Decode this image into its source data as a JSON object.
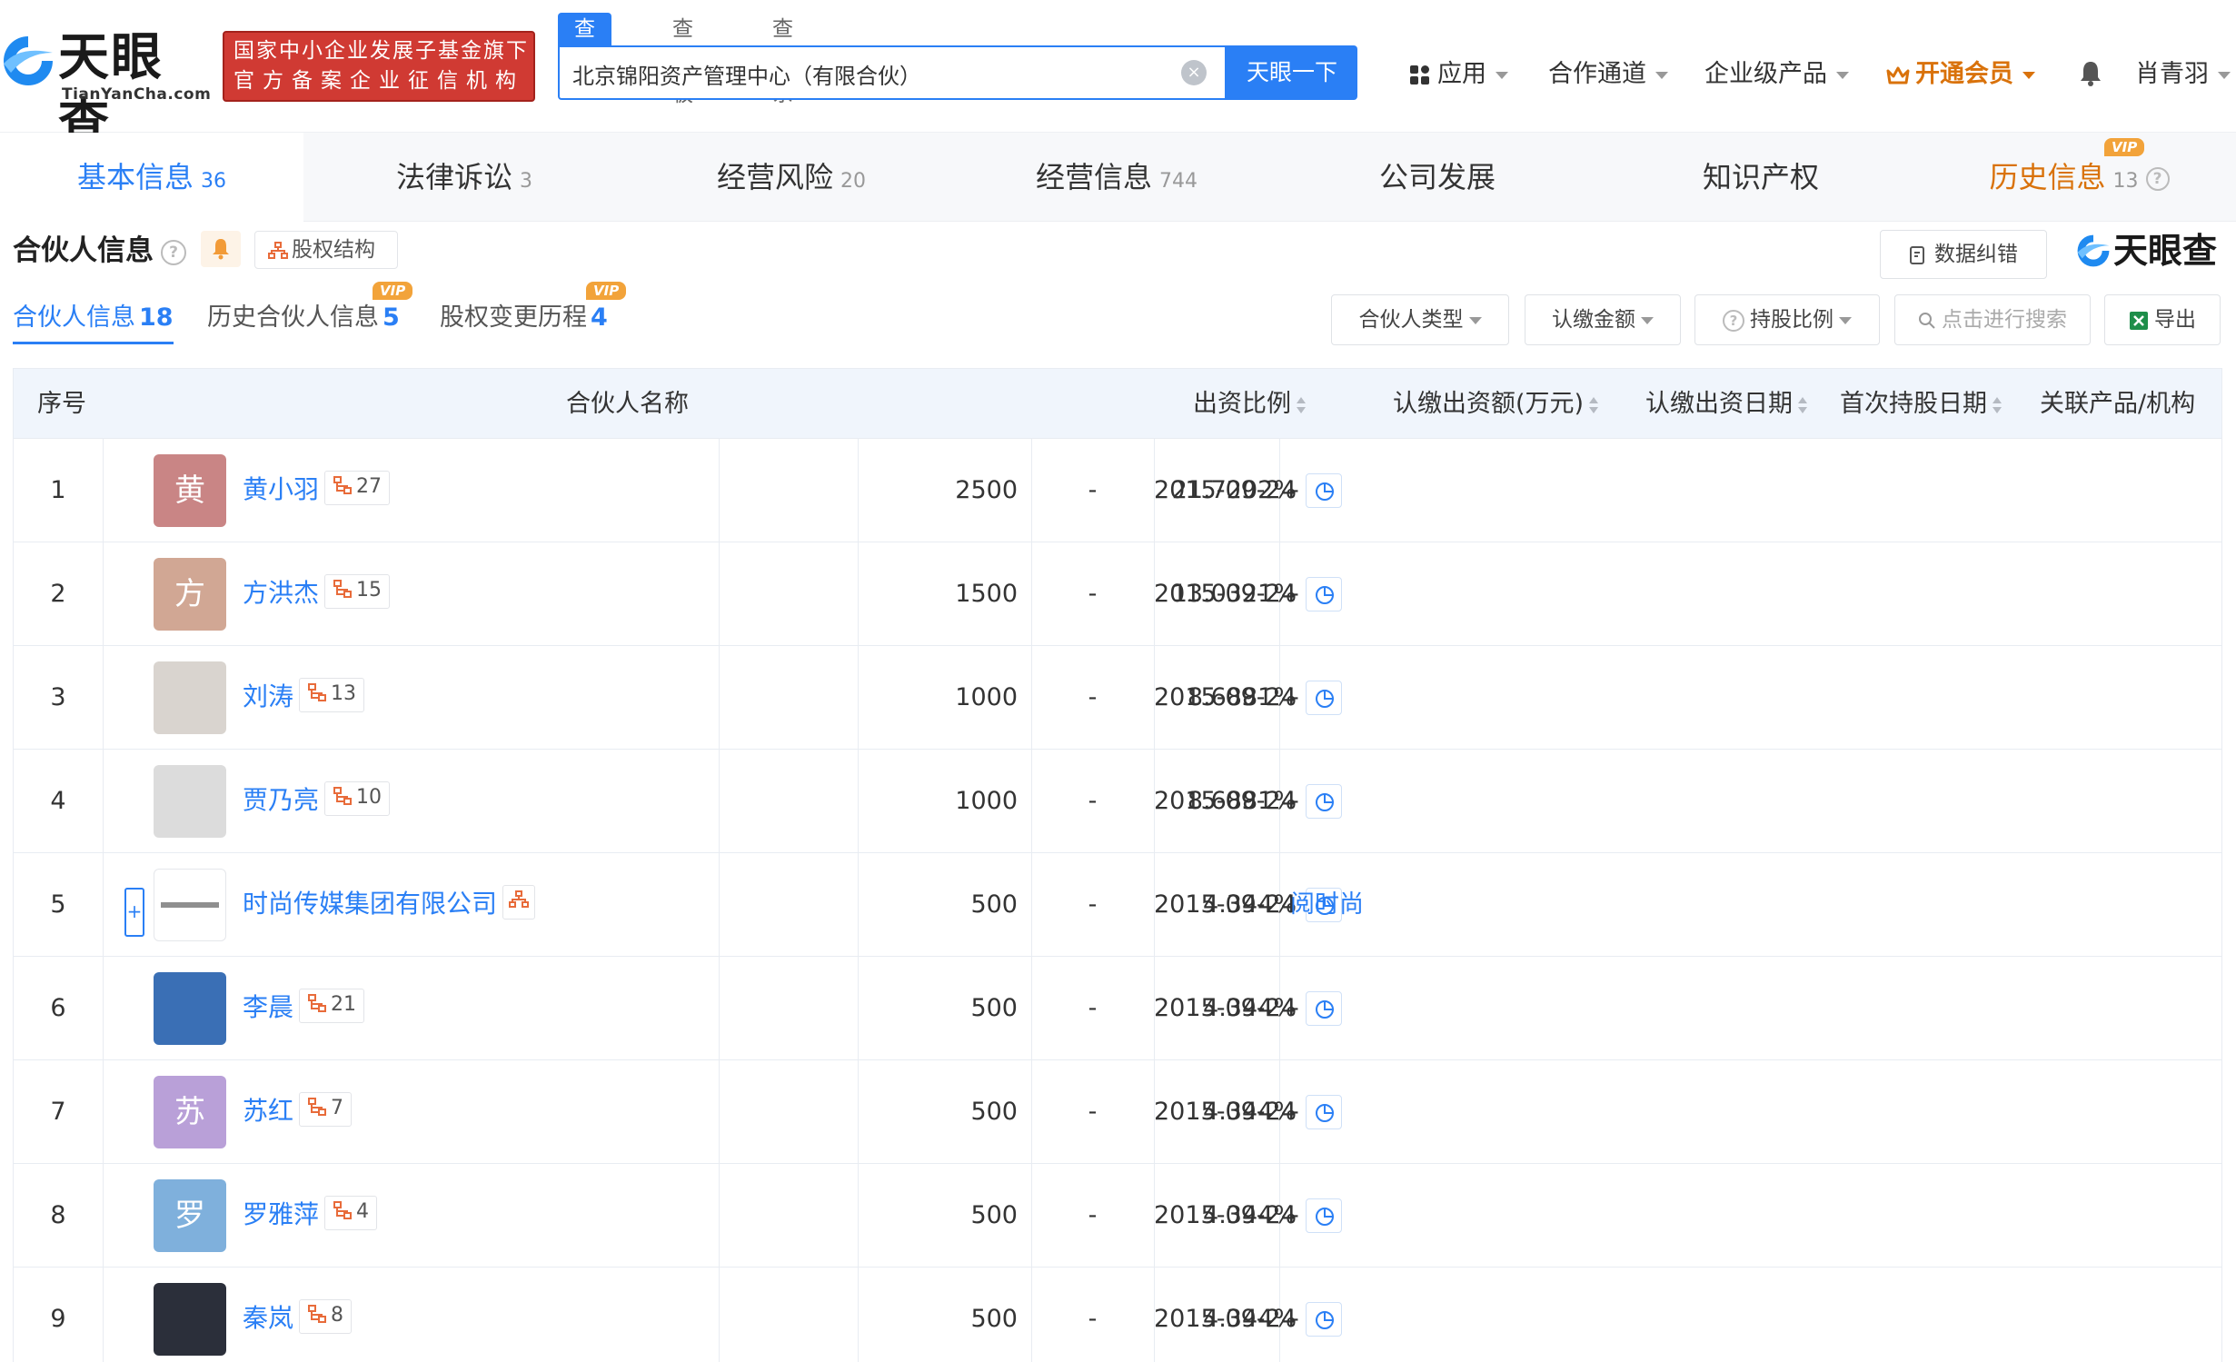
{
  "header": {
    "logo_cn": "天眼查",
    "logo_en": "TianYanCha.com",
    "org_badge_line1": "国家中小企业发展子基金旗下",
    "org_badge_line2": "官方备案企业征信机构",
    "search_tabs": [
      "查公司",
      "查老板",
      "查关系"
    ],
    "search_value": "北京锦阳资产管理中心（有限合伙）",
    "search_clear": "×",
    "search_button": "天眼一下",
    "nav": {
      "apps": "应用",
      "cooperation": "合作通道",
      "enterprise": "企业级产品",
      "vip": "开通会员",
      "user": "肖青羽"
    }
  },
  "section_tabs": [
    {
      "label": "基本信息",
      "count": "36"
    },
    {
      "label": "法律诉讼",
      "count": "3"
    },
    {
      "label": "经营风险",
      "count": "20"
    },
    {
      "label": "经营信息",
      "count": "744"
    },
    {
      "label": "公司发展",
      "count": ""
    },
    {
      "label": "知识产权",
      "count": ""
    },
    {
      "label": "历史信息",
      "count": "13"
    }
  ],
  "vip_tag": "VIP",
  "section": {
    "title": "合伙人信息",
    "equity_button": "股权结构",
    "correct_button": "数据纠错",
    "brand": "天眼查"
  },
  "subtabs": [
    {
      "label": "合伙人信息",
      "count": "18"
    },
    {
      "label": "历史合伙人信息",
      "count": "5"
    },
    {
      "label": "股权变更历程",
      "count": "4"
    }
  ],
  "filters": {
    "partner_type": "合伙人类型",
    "amount": "认缴金额",
    "ratio": "持股比例",
    "search_placeholder": "点击进行搜索",
    "export": "导出"
  },
  "table": {
    "headers": [
      "序号",
      "合伙人名称",
      "出资比例",
      "认缴出资额(万元)",
      "认缴出资日期",
      "首次持股日期",
      "关联产品/机构"
    ],
    "rows": [
      {
        "idx": "1",
        "name": "黄小羽",
        "avatar_char": "黄",
        "avatar_color": "#c98585",
        "rel": "27",
        "ratio": "21.7202%",
        "amount": "2500",
        "sub_date": "-",
        "first_date": "2015-09-24",
        "related": "-"
      },
      {
        "idx": "2",
        "name": "方洪杰",
        "avatar_char": "方",
        "avatar_color": "#d1a794",
        "rel": "15",
        "ratio": "13.0321%",
        "amount": "1500",
        "sub_date": "-",
        "first_date": "2015-09-24",
        "related": "-"
      },
      {
        "idx": "3",
        "name": "刘涛",
        "avatar_char": "",
        "avatar_color": "#d9d4cf",
        "rel": "13",
        "ratio": "8.6881%",
        "amount": "1000",
        "sub_date": "-",
        "first_date": "2015-09-24",
        "related": "-"
      },
      {
        "idx": "4",
        "name": "贾乃亮",
        "avatar_char": "",
        "avatar_color": "#dcdcdc",
        "rel": "10",
        "ratio": "8.6881%",
        "amount": "1000",
        "sub_date": "-",
        "first_date": "2015-09-24",
        "related": "-"
      },
      {
        "idx": "5",
        "name": "时尚传媒集团有限公司",
        "avatar_char": "",
        "avatar_color": "#ffffff",
        "rel": "",
        "ratio": "4.344%",
        "amount": "500",
        "sub_date": "-",
        "first_date": "2015-09-24",
        "related": "阅时尚"
      },
      {
        "idx": "6",
        "name": "李晨",
        "avatar_char": "",
        "avatar_color": "#3a6fb5",
        "rel": "21",
        "ratio": "4.344%",
        "amount": "500",
        "sub_date": "-",
        "first_date": "2015-09-24",
        "related": "-"
      },
      {
        "idx": "7",
        "name": "苏红",
        "avatar_char": "苏",
        "avatar_color": "#b9a0d8",
        "rel": "7",
        "ratio": "4.344%",
        "amount": "500",
        "sub_date": "-",
        "first_date": "2015-09-24",
        "related": "-"
      },
      {
        "idx": "8",
        "name": "罗雅萍",
        "avatar_char": "罗",
        "avatar_color": "#7fb0dc",
        "rel": "4",
        "ratio": "4.344%",
        "amount": "500",
        "sub_date": "-",
        "first_date": "2015-09-24",
        "related": "-"
      },
      {
        "idx": "9",
        "name": "秦岚",
        "avatar_char": "",
        "avatar_color": "#2b2f3a",
        "rel": "8",
        "ratio": "4.344%",
        "amount": "500",
        "sub_date": "-",
        "first_date": "2015-09-24",
        "related": "-"
      }
    ]
  },
  "colors": {
    "accent": "#2a7ff5",
    "vip": "#d9720b",
    "badge_red": "#d03a33"
  }
}
